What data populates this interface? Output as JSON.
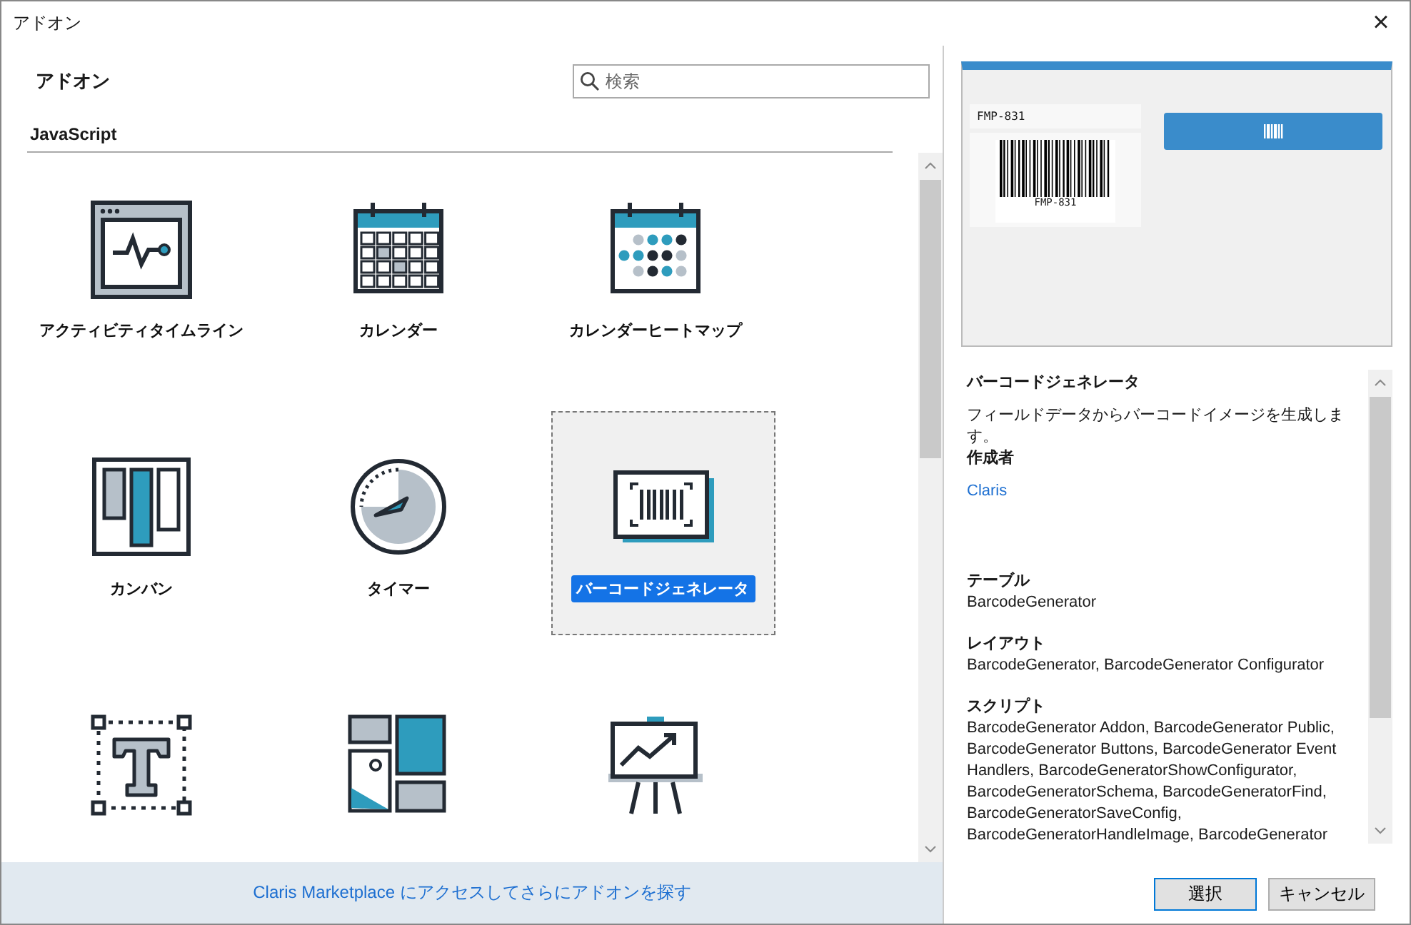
{
  "window": {
    "title": "アドオン",
    "close": "×"
  },
  "header": {
    "title": "アドオン",
    "search": {
      "placeholder": "検索"
    }
  },
  "section": "JavaScript",
  "addons": [
    {
      "kind": "timeline",
      "label": "アクティビティタイムライン",
      "selected": false
    },
    {
      "kind": "calendar",
      "label": "カレンダー",
      "selected": false
    },
    {
      "kind": "heatmap",
      "label": "カレンダーヒートマップ",
      "selected": false
    },
    {
      "kind": "kanban",
      "label": "カンバン",
      "selected": false
    },
    {
      "kind": "timer",
      "label": "タイマー",
      "selected": false
    },
    {
      "kind": "barcode",
      "label": "バーコードジェネレータ",
      "selected": true
    },
    {
      "kind": "text",
      "selected": false
    },
    {
      "kind": "gallery",
      "selected": false
    },
    {
      "kind": "presentation",
      "selected": false
    }
  ],
  "footer_link": "Claris Marketplace にアクセスしてさらにアドオンを探す",
  "preview": {
    "field_value": "FMP-831",
    "barcode_text": "FMP-831"
  },
  "details": {
    "name": "バーコードジェネレータ",
    "description": "フィールドデータからバーコードイメージを生成します。",
    "author_label": "作成者",
    "author": "Claris",
    "sections": [
      {
        "label": "テーブル",
        "value": "BarcodeGenerator"
      },
      {
        "label": "レイアウト",
        "value": "BarcodeGenerator, BarcodeGenerator Configurator"
      },
      {
        "label": "スクリプト",
        "value": "BarcodeGenerator Addon, BarcodeGenerator Public, BarcodeGenerator Buttons, BarcodeGenerator Event Handlers, BarcodeGeneratorShowConfigurator, BarcodeGeneratorSchema, BarcodeGeneratorFind, BarcodeGeneratorSaveConfig, BarcodeGeneratorHandleImage, BarcodeGenerator"
      }
    ]
  },
  "buttons": [
    {
      "label": "選択",
      "default": true
    },
    {
      "label": "キャンセル",
      "default": false
    }
  ]
}
